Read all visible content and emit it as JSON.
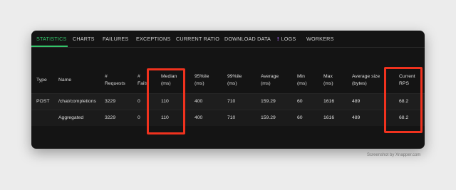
{
  "tabs": [
    {
      "label": "STATISTICS"
    },
    {
      "label": "CHARTS"
    },
    {
      "label": "FAILURES"
    },
    {
      "label": "EXCEPTIONS"
    },
    {
      "label": "CURRENT RATIO"
    },
    {
      "label": "DOWNLOAD DATA"
    },
    {
      "label": "LOGS",
      "icon": "!"
    },
    {
      "label": "WORKERS"
    }
  ],
  "columns": [
    {
      "l1": "Type",
      "l2": ""
    },
    {
      "l1": "Name",
      "l2": ""
    },
    {
      "l1": "#",
      "l2": "Requests"
    },
    {
      "l1": "#",
      "l2": "Fails"
    },
    {
      "l1": "Median",
      "l2": "(ms)"
    },
    {
      "l1": "95%ile",
      "l2": "(ms)"
    },
    {
      "l1": "99%ile",
      "l2": "(ms)"
    },
    {
      "l1": "Average",
      "l2": "(ms)"
    },
    {
      "l1": "Min",
      "l2": "(ms)"
    },
    {
      "l1": "Max",
      "l2": "(ms)"
    },
    {
      "l1": "Average size",
      "l2": "(bytes)"
    },
    {
      "l1": "Current",
      "l2": "RPS"
    }
  ],
  "rows": [
    [
      "POST",
      "/chat/completions",
      "3229",
      "0",
      "110",
      "400",
      "710",
      "159.29",
      "60",
      "1616",
      "489",
      "68.2"
    ],
    [
      "",
      "Aggregated",
      "3229",
      "0",
      "110",
      "400",
      "710",
      "159.29",
      "60",
      "1616",
      "489",
      "68.2"
    ]
  ],
  "watermark": "Screenshot by Xnapper.com",
  "colors": {
    "accent": "#34c46a",
    "highlight": "#f0321e",
    "icon": "#b06cff"
  }
}
